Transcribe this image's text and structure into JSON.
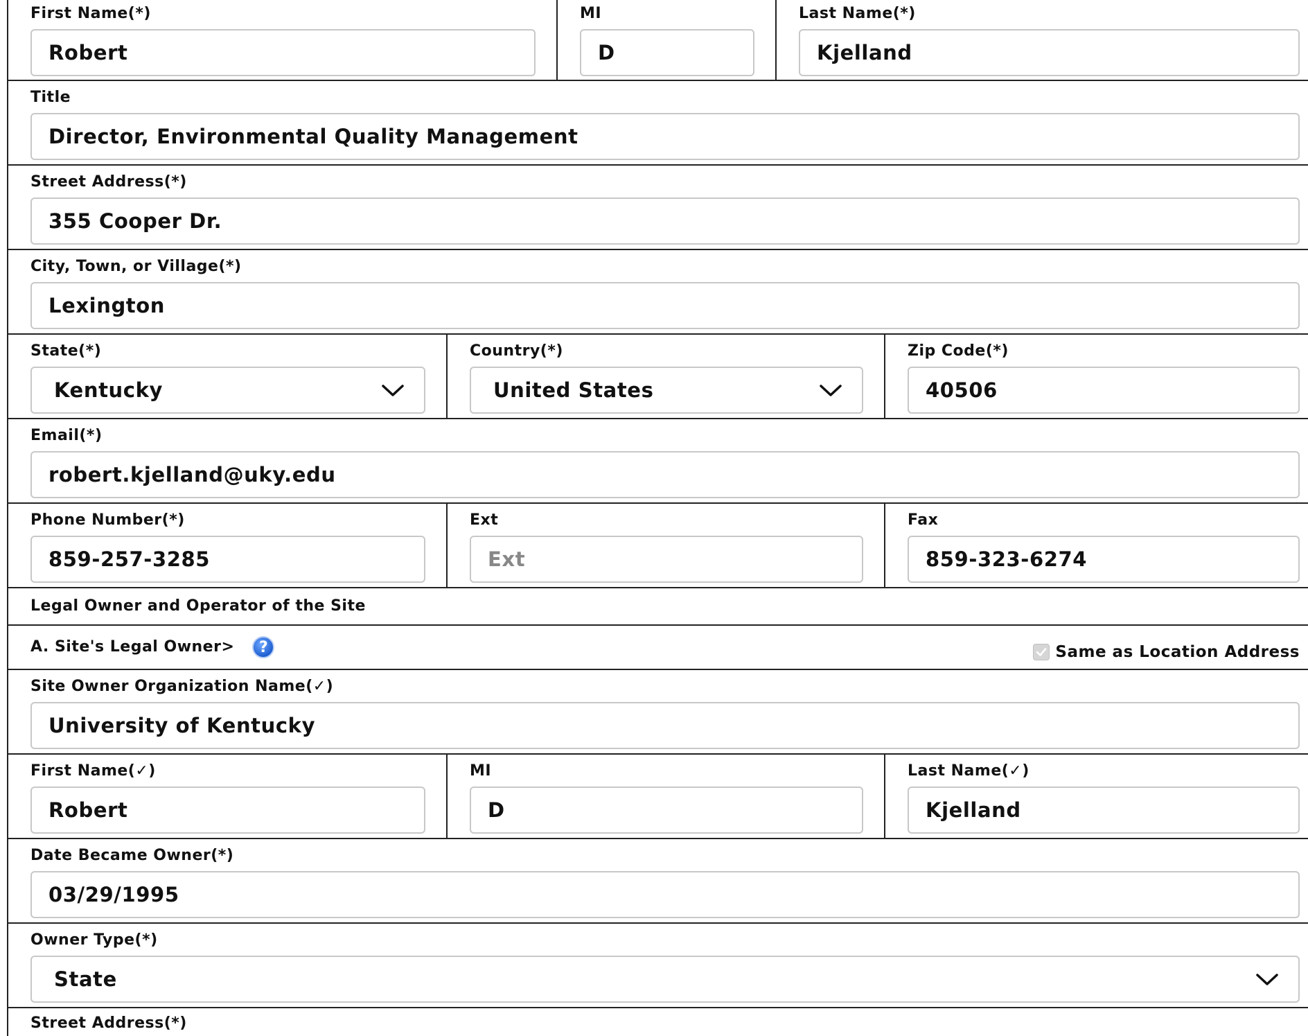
{
  "operator": {
    "first_name": {
      "label": "First Name(*)",
      "value": "Robert"
    },
    "mi": {
      "label": "MI",
      "value": "D"
    },
    "last_name": {
      "label": "Last Name(*)",
      "value": "Kjelland"
    },
    "title": {
      "label": "Title",
      "value": "Director, Environmental Quality Management"
    },
    "street": {
      "label": "Street Address(*)",
      "value": "355 Cooper Dr."
    },
    "city": {
      "label": "City, Town, or Village(*)",
      "value": "Lexington"
    },
    "state": {
      "label": "State(*)",
      "value": "Kentucky"
    },
    "country": {
      "label": "Country(*)",
      "value": "United States"
    },
    "zip": {
      "label": "Zip Code(*)",
      "value": "40506"
    },
    "email": {
      "label": "Email(*)",
      "value": "robert.kjelland@uky.edu"
    },
    "phone": {
      "label": "Phone Number(*)",
      "value": "859-257-3285"
    },
    "ext": {
      "label": "Ext",
      "placeholder": "Ext"
    },
    "fax": {
      "label": "Fax",
      "value": "859-323-6274"
    }
  },
  "section_heading": "Legal Owner and Operator of the Site",
  "owner_heading": "A. Site's Legal Owner>",
  "help_icon": "question-mark-icon",
  "same_as_location": {
    "label": "Same as Location Address",
    "checked": true
  },
  "owner": {
    "org_name": {
      "label": "Site Owner Organization Name(✓)",
      "value": "University of Kentucky"
    },
    "first_name": {
      "label": "First Name(✓)",
      "value": "Robert"
    },
    "mi": {
      "label": "MI",
      "value": "D"
    },
    "last_name": {
      "label": "Last Name(✓)",
      "value": "Kjelland"
    },
    "date_became_owner": {
      "label": "Date Became Owner(*)",
      "value": "03/29/1995"
    },
    "owner_type": {
      "label": "Owner Type(*)",
      "value": "State"
    },
    "street": {
      "label": "Street Address(*)"
    }
  }
}
